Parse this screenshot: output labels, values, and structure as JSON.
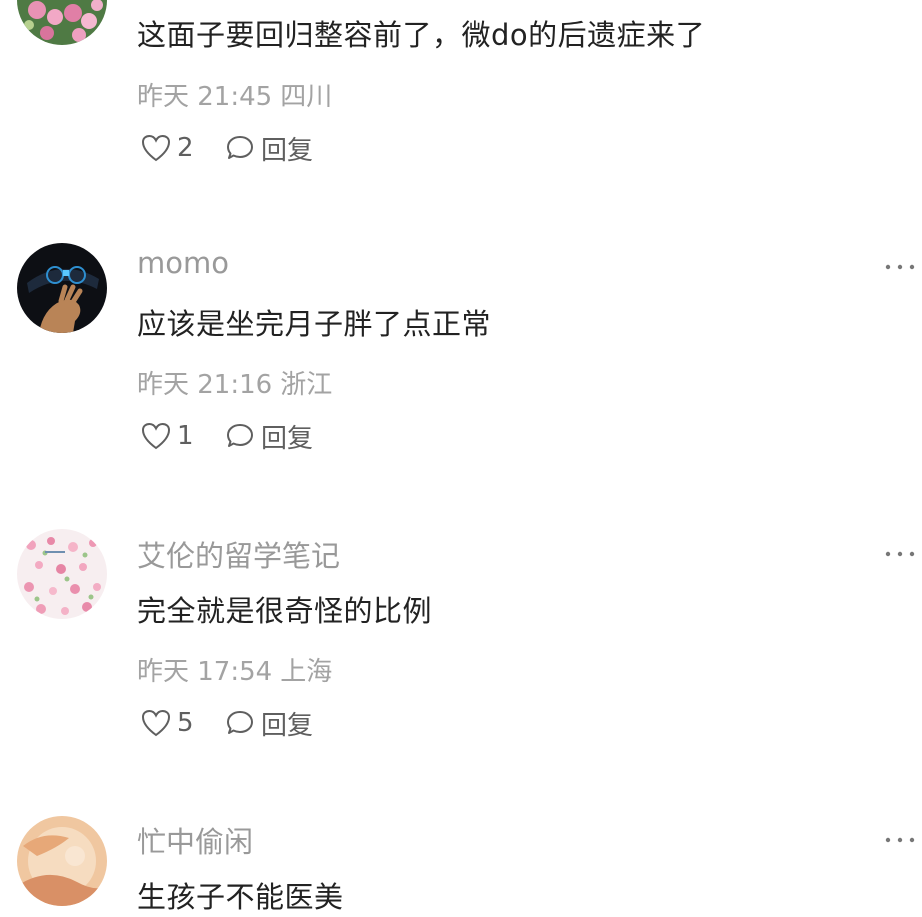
{
  "comments": [
    {
      "username": "",
      "content": "这面子要回归整容前了，微do的后遗症来了",
      "time": "昨天 21:45",
      "location": "四川",
      "likes": "2",
      "reply_label": "回复"
    },
    {
      "username": "momo",
      "content": "应该是坐完月子胖了点正常",
      "time": "昨天 21:16",
      "location": "浙江",
      "likes": "1",
      "reply_label": "回复"
    },
    {
      "username": "艾伦的留学笔记",
      "content": "完全就是很奇怪的比例",
      "time": "昨天 17:54",
      "location": "上海",
      "likes": "5",
      "reply_label": "回复"
    },
    {
      "username": "忙中偷闲",
      "content": "生孩子不能医美",
      "time": "",
      "location": "",
      "likes": "",
      "reply_label": ""
    }
  ],
  "icons": {
    "like": "heart-outline-icon",
    "reply": "speech-bubble-icon",
    "more": "more-dots-icon"
  },
  "colors": {
    "content_text": "#222222",
    "secondary_text": "#999999",
    "action_text": "#5f5f5f"
  }
}
